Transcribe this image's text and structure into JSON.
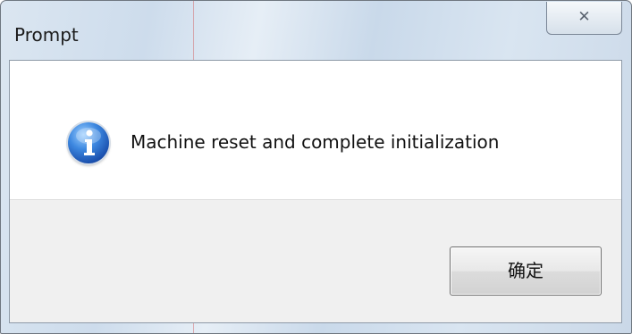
{
  "window": {
    "title": "Prompt",
    "close_glyph": "✕"
  },
  "dialog": {
    "icon": "information-icon",
    "message": "Machine reset and complete initialization",
    "ok_label": "确定"
  },
  "colors": {
    "icon_blue": "#1a4fad",
    "footer_bg": "#f0f0f0"
  }
}
